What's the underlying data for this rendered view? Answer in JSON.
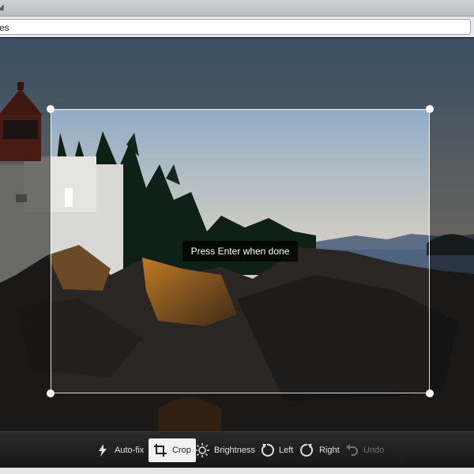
{
  "browser": {
    "address_text": "es"
  },
  "editor": {
    "hint": "Press Enter when done",
    "photo_description_icon": "lighthouse-landscape-photo"
  },
  "toolbar": {
    "autofix_label": "Auto-fix",
    "crop_label": "Crop",
    "brightness_label": "Brightness",
    "left_label": "Left",
    "right_label": "Right",
    "undo_label": "Undo",
    "active_tool": "Crop"
  },
  "colors": {
    "toolbar_bg": "#1f1f1f",
    "active_tool_bg": "#f2f2f2",
    "disabled_text": "#6f6f6f",
    "sky_top": "#8fb4d9",
    "sky_bottom": "#f2a45e"
  }
}
